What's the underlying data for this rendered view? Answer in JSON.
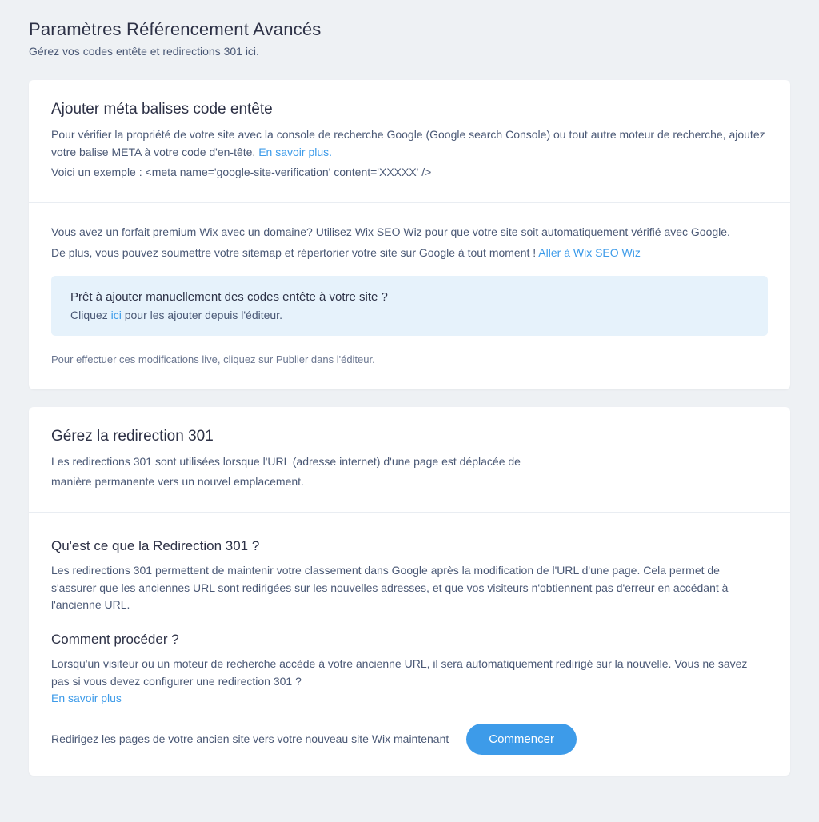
{
  "page": {
    "title": "Paramètres Référencement Avancés",
    "subtitle": "Gérez vos codes entête et redirections 301 ici."
  },
  "meta_card": {
    "heading": "Ajouter méta balises code entête",
    "desc": "Pour vérifier la propriété de votre site avec la console de recherche Google (Google search Console) ou tout autre moteur de recherche, ajoutez votre balise META à votre code d'en-tête. ",
    "learn_more": "En savoir plus.",
    "example_prefix": "Voici un exemple : ",
    "example_code": "<meta name='google-site-verification' content='XXXXX' />",
    "premium_line1": "Vous avez un forfait premium Wix avec un domaine? Utilisez Wix SEO Wiz pour que votre site soit automatiquement vérifié avec Google.",
    "premium_line2_pre": "De plus, vous pouvez soumettre votre sitemap et répertorier votre site sur Google à tout moment ! ",
    "seo_wiz_link": "Aller à Wix SEO Wiz",
    "banner_q": "Prêt à ajouter manuellement des codes entête à votre site ?",
    "banner_a_pre": "Cliquez ",
    "banner_a_link": "ici",
    "banner_a_post": " pour les ajouter depuis l'éditeur.",
    "footer_note": "Pour effectuer ces modifications live, cliquez sur Publier dans l'éditeur."
  },
  "redirect_card": {
    "heading": "Gérez la redirection 301",
    "desc_line1": "Les redirections 301 sont utilisées lorsque l'URL (adresse internet) d'une page est déplacée de",
    "desc_line2": "manière permanente vers un nouvel emplacement.",
    "what_heading": "Qu'est ce que la Redirection 301 ?",
    "what_desc": "Les redirections 301 permettent de maintenir votre classement dans Google après la modification de l'URL d'une page. Cela permet de s'assurer que les anciennes URL sont redirigées sur les nouvelles adresses, et que vos visiteurs n'obtiennent pas d'erreur en accédant à l'ancienne URL.",
    "how_heading": "Comment procéder ?",
    "how_desc": "Lorsqu'un visiteur ou un moteur de recherche accède à votre ancienne URL, il sera automatiquement redirigé sur la nouvelle. Vous ne savez pas si vous devez configurer une redirection 301 ?",
    "how_link": "En savoir plus",
    "cta_text": "Redirigez les pages de votre ancien site vers votre nouveau site Wix maintenant",
    "cta_button": "Commencer"
  }
}
